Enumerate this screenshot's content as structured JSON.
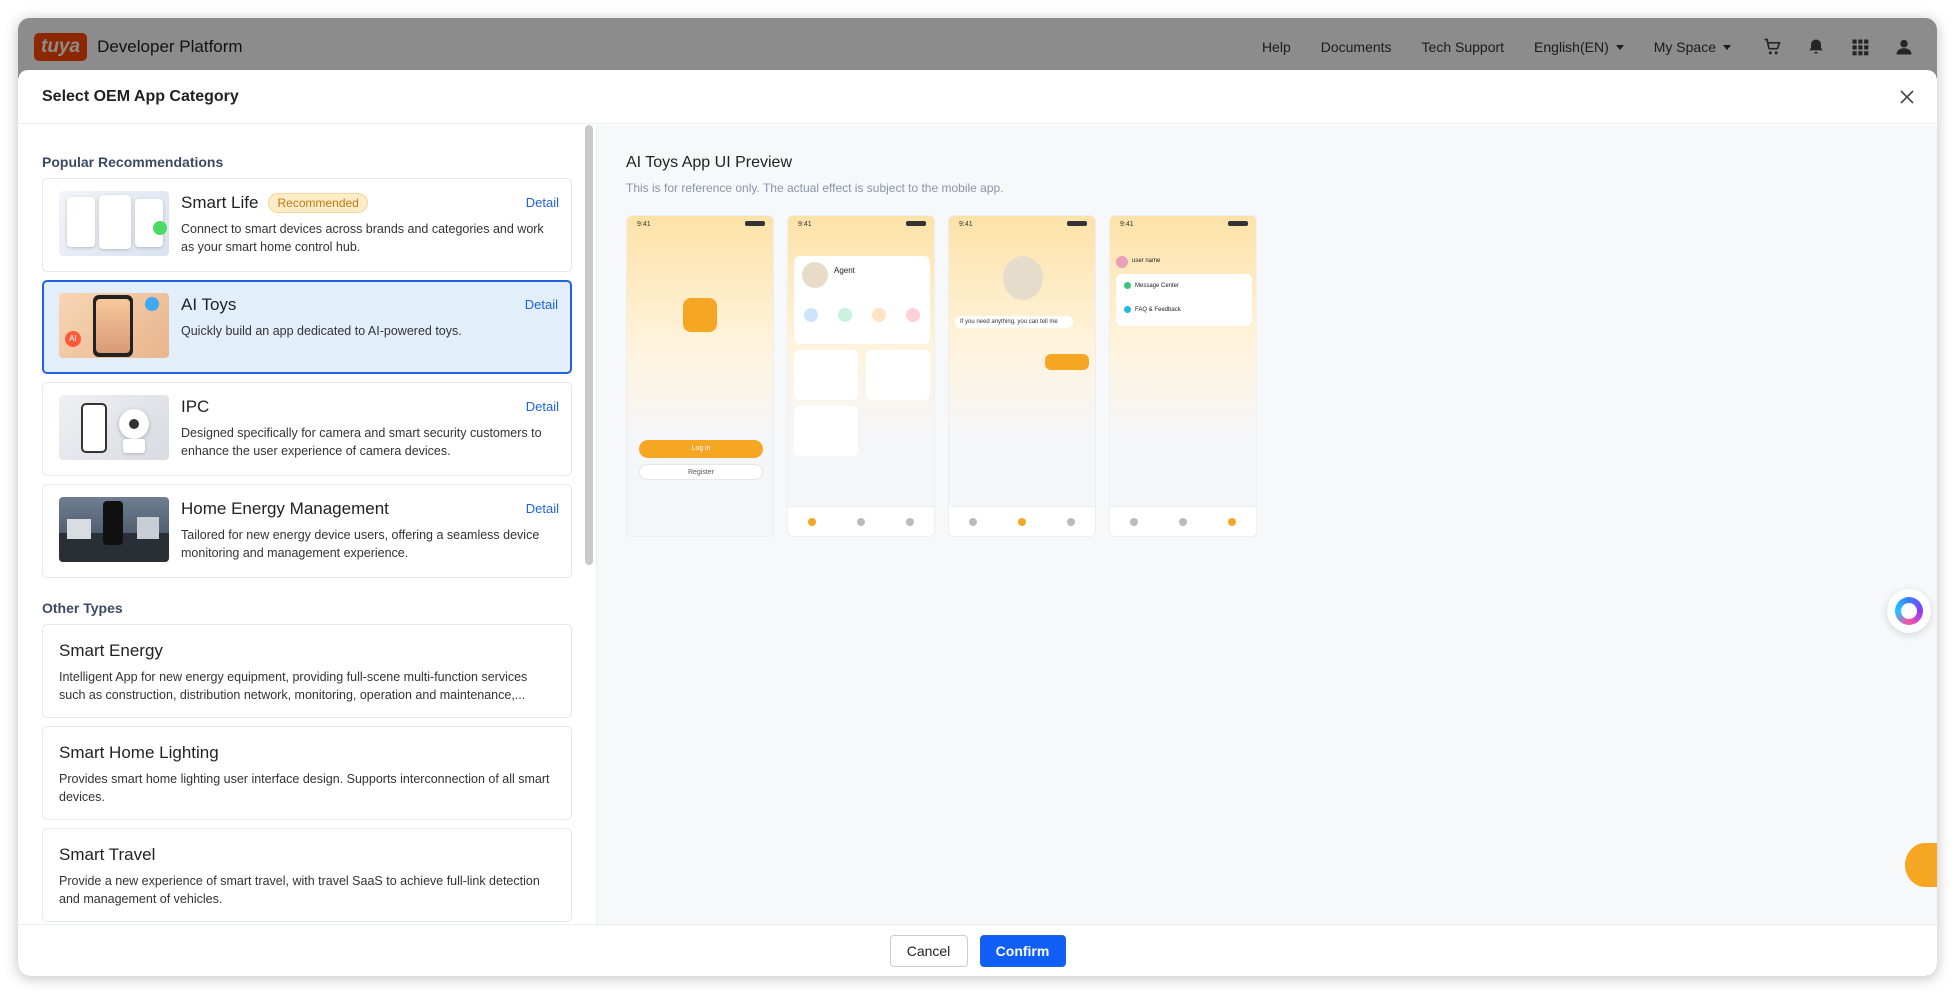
{
  "topbar": {
    "logo": "tuya",
    "brand": "Developer Platform",
    "links": [
      "Help",
      "Documents",
      "Tech Support"
    ],
    "language": "English(EN)",
    "space": "My Space",
    "icons": [
      "cart-icon",
      "bell-icon",
      "apps-grid-icon",
      "user-icon"
    ]
  },
  "modal": {
    "title": "Select OEM App Category",
    "popular_title": "Popular Recommendations",
    "other_title": "Other Types",
    "detail_label": "Detail",
    "recommended_badge": "Recommended",
    "popular": [
      {
        "title": "Smart Life",
        "badge": true,
        "desc": "Connect to smart devices across brands and categories and work as your smart home control hub.",
        "selected": false
      },
      {
        "title": "AI Toys",
        "badge": false,
        "desc": "Quickly build an app dedicated to AI-powered toys.",
        "selected": true
      },
      {
        "title": "IPC",
        "badge": false,
        "desc": "Designed specifically for camera and smart security customers to enhance the user experience of camera devices.",
        "selected": false
      },
      {
        "title": "Home Energy Management",
        "badge": false,
        "desc": "Tailored for new energy device users, offering a seamless device monitoring and management experience.",
        "selected": false
      }
    ],
    "other": [
      {
        "title": "Smart Energy",
        "desc": "Intelligent App for new energy equipment, providing full-scene multi-function services such as construction, distribution network, monitoring, operation and maintenance,..."
      },
      {
        "title": "Smart Home Lighting",
        "desc": "Provides smart home lighting user interface design. Supports interconnection of all smart devices."
      },
      {
        "title": "Smart Travel",
        "desc": "Provide a new experience of smart travel, with travel SaaS to achieve full-link detection and management of vehicles."
      }
    ],
    "preview": {
      "title": "AI Toys App UI Preview",
      "subtitle": "This is for reference only. The actual effect is subject to the mobile app.",
      "phones": [
        {
          "time": "9:41",
          "login": "Log in",
          "register": "Register"
        },
        {
          "time": "9:41",
          "agent": "Agent"
        },
        {
          "time": "9:41",
          "bubble": "If you need anything, you can tell me"
        },
        {
          "time": "9:41",
          "user": "user name",
          "menu": [
            "Message Center",
            "FAQ & Feedback"
          ]
        }
      ]
    },
    "footer": {
      "cancel": "Cancel",
      "confirm": "Confirm"
    }
  },
  "colors": {
    "primary": "#0f5ef5",
    "selected_bg": "#e3eefb",
    "badge_bg": "#fdecc8",
    "brand_orange": "#ff4800"
  }
}
